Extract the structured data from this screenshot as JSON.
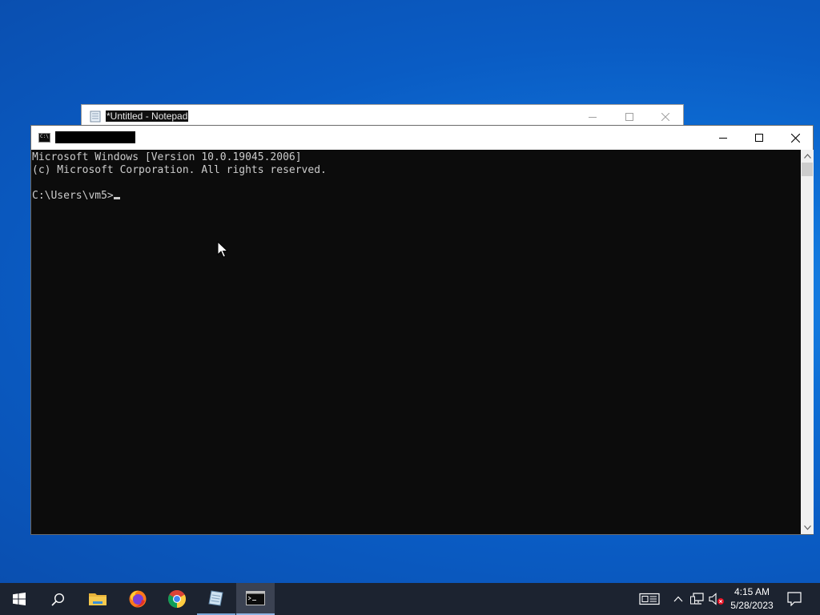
{
  "desktop": {
    "background_color": "#0a5cc4"
  },
  "notepad": {
    "title": "*Untitled - Notepad",
    "icon": "notepad-icon",
    "buttons": [
      "minimize-icon",
      "maximize-icon",
      "close-icon"
    ]
  },
  "cmd": {
    "title": "",
    "icon": "cmd-icon",
    "icon_text": "C:\\",
    "buttons": [
      "minimize-icon",
      "maximize-icon",
      "close-icon"
    ],
    "console_lines": [
      "Microsoft Windows [Version 10.0.19045.2006]",
      "(c) Microsoft Corporation. All rights reserved.",
      "",
      "C:\\Users\\vm5>"
    ],
    "background_color": "#0c0c0c",
    "text_color": "#cccccc"
  },
  "taskbar": {
    "items": [
      {
        "name": "start-button",
        "icon": "windows-icon"
      },
      {
        "name": "search-button",
        "icon": "search-icon"
      },
      {
        "name": "file-explorer",
        "icon": "folder-icon"
      },
      {
        "name": "firefox",
        "icon": "firefox-icon"
      },
      {
        "name": "chrome",
        "icon": "chrome-icon"
      },
      {
        "name": "notepad",
        "icon": "notepad-icon",
        "state": "running"
      },
      {
        "name": "command-prompt",
        "icon": "cmd-icon",
        "state": "active"
      }
    ],
    "tray": [
      "news-icon",
      "chevron-up-icon",
      "network-icon",
      "volume-muted-icon"
    ],
    "clock": {
      "time": "4:15 AM",
      "date": "5/28/2023"
    },
    "notification_icon": "notification-icon",
    "background_color": "#1c2330"
  }
}
